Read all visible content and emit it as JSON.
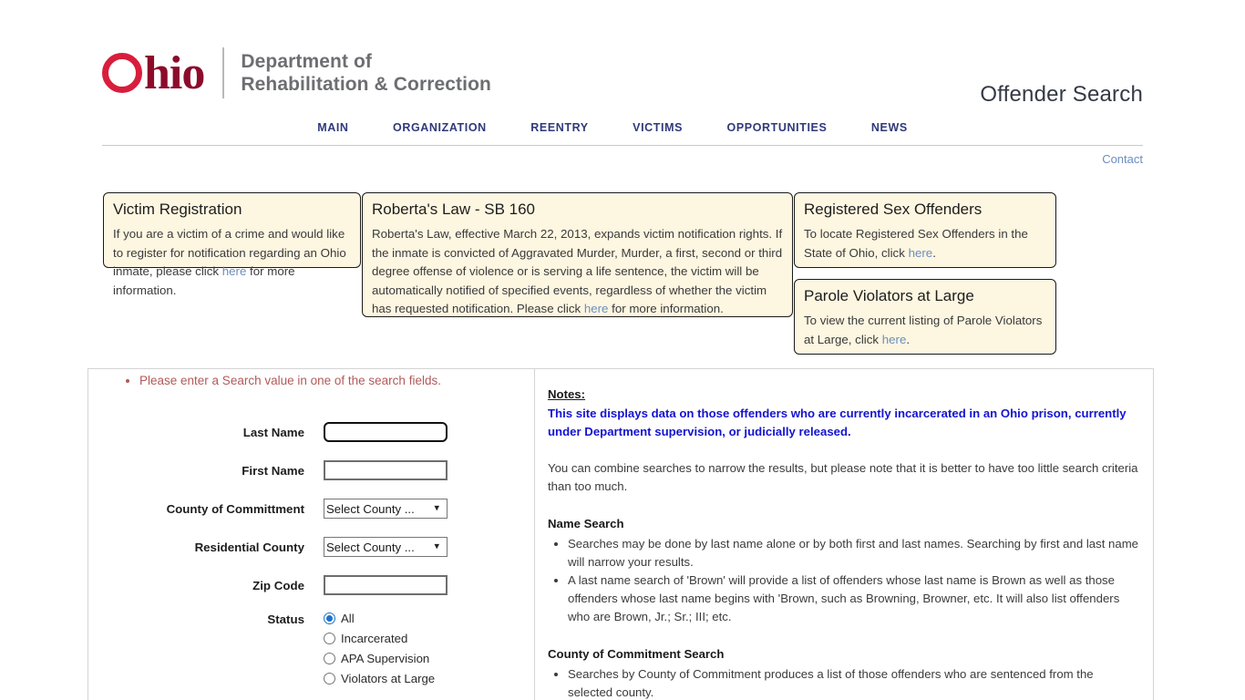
{
  "header": {
    "logo_o": "O",
    "logo_hio": "hio",
    "dept_line1": "Department of",
    "dept_line2": "Rehabilitation & Correction",
    "page_title": "Offender Search",
    "contact_label": "Contact"
  },
  "nav": {
    "items": [
      {
        "label": "MAIN"
      },
      {
        "label": "ORGANIZATION"
      },
      {
        "label": "REENTRY"
      },
      {
        "label": "VICTIMS"
      },
      {
        "label": "OPPORTUNITIES"
      },
      {
        "label": "NEWS"
      }
    ]
  },
  "info_boxes": {
    "victim_registration": {
      "title": "Victim Registration",
      "body_before_link": "If you are a victim of a crime and would like to register for notification regarding an Ohio inmate, please click ",
      "link": "here",
      "body_after_link": " for more information."
    },
    "robertas_law": {
      "title": "Roberta's Law - SB 160",
      "body_before_link": "Roberta's Law, effective March 22, 2013, expands victim notification rights. If the inmate is convicted of Aggravated Murder, Murder, a first, second or third degree offense of violence or is serving a life sentence, the victim will be automatically notified of specified events, regardless of whether the victim has requested notification. Please click ",
      "link": "here",
      "body_after_link": " for more information."
    },
    "registered_sex_offenders": {
      "title": "Registered Sex Offenders",
      "body_before_link": "To locate Registered Sex Offenders in the State of Ohio, click ",
      "link": "here",
      "body_after_link": "."
    },
    "parole_violators": {
      "title": "Parole Violators at Large",
      "body_before_link": "To view the current listing of Parole Violators at Large, click ",
      "link": "here",
      "body_after_link": "."
    }
  },
  "search_form": {
    "alert": "Please enter a Search value in one of the search fields.",
    "fields": {
      "last_name": {
        "label": "Last Name",
        "value": "",
        "placeholder": ""
      },
      "first_name": {
        "label": "First Name",
        "value": "",
        "placeholder": ""
      },
      "county_of_committment": {
        "label": "County of Committment",
        "selected": "Select County ..."
      },
      "residential_county": {
        "label": "Residential County",
        "selected": "Select County ..."
      },
      "zip_code": {
        "label": "Zip Code",
        "value": "",
        "placeholder": ""
      },
      "status": {
        "label": "Status",
        "options": [
          {
            "label": "All",
            "selected": true
          },
          {
            "label": "Incarcerated",
            "selected": false
          },
          {
            "label": "APA Supervision",
            "selected": false
          },
          {
            "label": "Violators at Large",
            "selected": false
          }
        ]
      }
    },
    "chevron_glyph": "❯"
  },
  "notes": {
    "heading": "Notes:",
    "highlight": "This site displays data on those offenders who are currently incarcerated in an Ohio prison, currently under Department supervision, or judicially released.",
    "paragraph": "You can combine searches to narrow the results, but please note that it is better to have too little search criteria than too much.",
    "sections": [
      {
        "title": "Name Search",
        "bullets": [
          "Searches may be done by last name alone or by both first and last names. Searching by first and last name will narrow your results.",
          "A last name search of 'Brown' will provide a list of offenders whose last name is Brown as well as those offenders whose last name begins with 'Brown, such as Browning, Browner, etc. It will also list offenders who are Brown, Jr.; Sr.; III; etc."
        ]
      },
      {
        "title": "County of Commitment Search",
        "bullets": [
          "Searches by County of Commitment produces a list of those offenders who are sentenced from the selected county."
        ]
      }
    ]
  },
  "colors": {
    "logo_ring": "#d81e3c",
    "logo_text": "#8c0b2b",
    "nav_link": "#2f3a7a",
    "infobox_bg": "#fdf6e1",
    "link_blue": "#6c8ebf",
    "alert_red": "#b35959",
    "notes_blue": "#1414cf",
    "radio_accent": "#1a73c9"
  }
}
